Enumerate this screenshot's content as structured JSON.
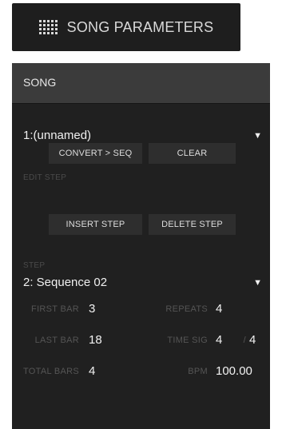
{
  "header": {
    "icon": "grid-icon",
    "title": "SONG PARAMETERS"
  },
  "panel": {
    "title": "SONG",
    "song_select": {
      "value": "1:(unnamed)",
      "caret": "▼"
    },
    "buttons": {
      "convert": "CONVERT > SEQ",
      "clear": "CLEAR",
      "insert_step": "INSERT STEP",
      "delete_step": "DELETE STEP"
    },
    "edit_step_label": "EDIT STEP",
    "step_label": "STEP",
    "step_select": {
      "value": "2: Sequence 02",
      "caret": "▼"
    },
    "params": {
      "first_bar": {
        "label": "FIRST BAR",
        "value": "3"
      },
      "repeats": {
        "label": "REPEATS",
        "value": "4"
      },
      "last_bar": {
        "label": "LAST BAR",
        "value": "18"
      },
      "time_sig": {
        "label": "TIME SIG",
        "numerator": "4",
        "separator": "/",
        "denominator": "4"
      },
      "total_bars": {
        "label": "TOTAL BARS",
        "value": "4"
      },
      "bpm": {
        "label": "BPM",
        "value": "100.00"
      }
    }
  }
}
